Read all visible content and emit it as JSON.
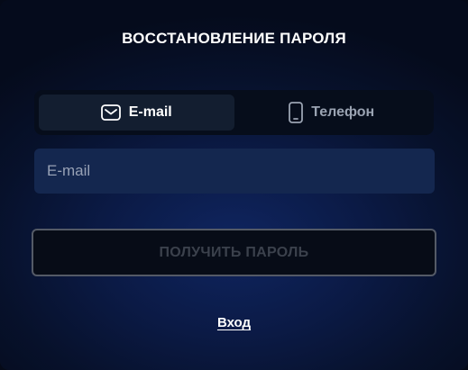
{
  "dialog": {
    "title": "ВОССТАНОВЛЕНИЕ ПАРОЛЯ"
  },
  "tabs": [
    {
      "label": "E-mail",
      "icon": "envelope-icon",
      "active": true
    },
    {
      "label": "Телефон",
      "icon": "phone-icon",
      "active": false
    }
  ],
  "email_field": {
    "placeholder": "E-mail",
    "value": ""
  },
  "submit_button": {
    "label": "ПОЛУЧИТЬ ПАРОЛЬ"
  },
  "login_link": {
    "label": "Вход"
  },
  "colors": {
    "background": "#0b1a45",
    "tab_active": "#131e30",
    "input_bg": "#14274f",
    "button_border": "#545a66",
    "button_text_disabled": "#3b414c"
  }
}
